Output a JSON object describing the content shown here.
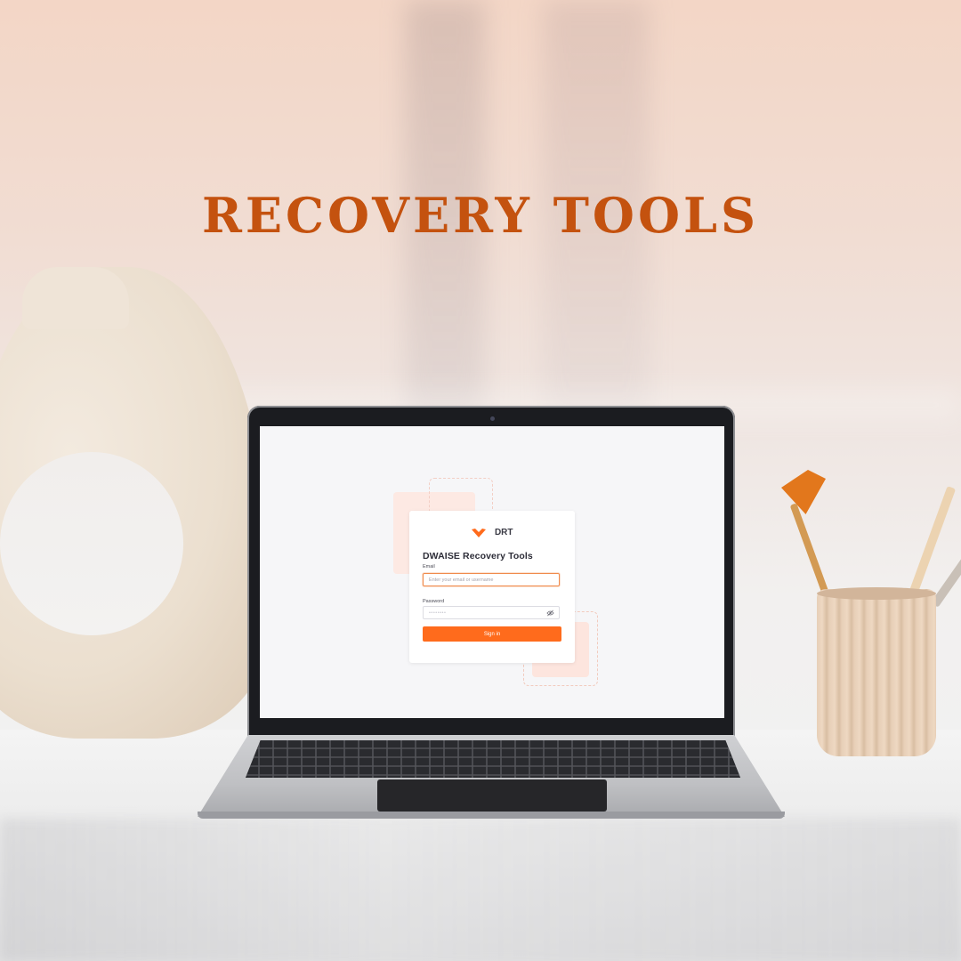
{
  "poster": {
    "headline": "RECOVERY TOOLS"
  },
  "login": {
    "brand_name": "DRT",
    "title": "DWAISE Recovery Tools",
    "email_label": "Email",
    "email_placeholder": "Enter your email or username",
    "password_label": "Password",
    "password_value": "••••••••",
    "signin_label": "Sign in"
  },
  "icons": {
    "brand": "chevron-heart-logo-icon",
    "password_toggle": "eye-off-icon"
  },
  "colors": {
    "accent": "#ff6b1c",
    "headline": "#c4520f",
    "focus_border": "#f08b4c"
  }
}
